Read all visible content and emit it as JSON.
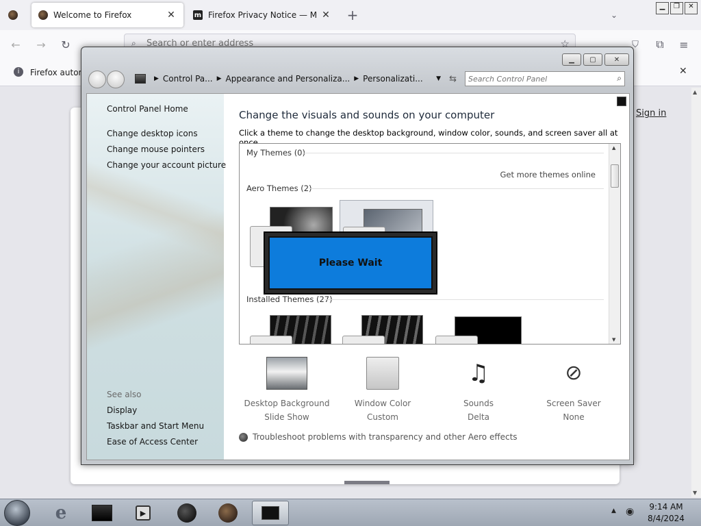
{
  "browser": {
    "tabs": [
      {
        "title": "Welcome to Firefox",
        "close": "✕"
      },
      {
        "title": "Firefox Privacy Notice — Mozill",
        "close": "✕"
      }
    ],
    "new_tab": "+",
    "url_placeholder": "Search or enter address",
    "notice_text": "Firefox autom",
    "sign_in": "Sign in"
  },
  "cp_window": {
    "breadcrumb": [
      "Control Pa...",
      "Appearance and Personaliza...",
      "Personalizati..."
    ],
    "search_placeholder": "Search Control Panel",
    "left_links": [
      "Control Panel Home",
      "Change desktop icons",
      "Change mouse pointers",
      "Change your account picture"
    ],
    "see_also_label": "See also",
    "see_also": [
      "Display",
      "Taskbar and Start Menu",
      "Ease of Access Center"
    ],
    "heading": "Change the visuals and sounds on your computer",
    "subheading": "Click a theme to change the desktop background, window color, sounds, and screen saver all at once.",
    "my_themes": "My Themes (0)",
    "get_more": "Get more themes online",
    "aero_themes": "Aero Themes (2)",
    "installed_themes": "Installed Themes (27)",
    "please_wait": "Please Wait",
    "customize": [
      {
        "label": "Desktop Background",
        "value": "Slide Show"
      },
      {
        "label": "Window Color",
        "value": "Custom"
      },
      {
        "label": "Sounds",
        "value": "Delta"
      },
      {
        "label": "Screen Saver",
        "value": "None"
      }
    ],
    "troubleshoot": "Troubleshoot problems with transparency and other Aero effects"
  },
  "taskbar": {
    "time": "9:14 AM",
    "date": "8/4/2024"
  },
  "colors": {
    "please_wait_bg": "#0d7cdc",
    "taskbar": "#aeb6c1"
  }
}
